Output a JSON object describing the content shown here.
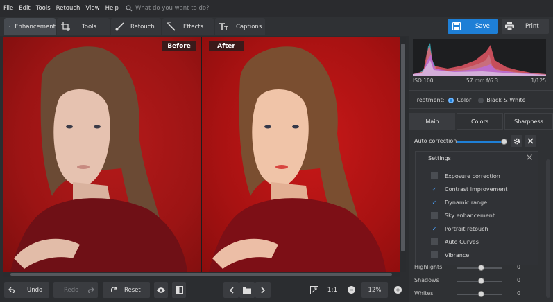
{
  "menu": {
    "items": [
      "File",
      "Edit",
      "Tools",
      "Retouch",
      "View",
      "Help"
    ],
    "search_placeholder": "What do you want to do?"
  },
  "toolbar": {
    "tabs": [
      {
        "label": "Enhancement",
        "icon": "sliders-icon"
      },
      {
        "label": "Tools",
        "icon": "crop-icon"
      },
      {
        "label": "Retouch",
        "icon": "brush-icon"
      },
      {
        "label": "Effects",
        "icon": "magic-wand-icon"
      },
      {
        "label": "Captions",
        "icon": "text-icon"
      }
    ],
    "save_label": "Save",
    "print_label": "Print"
  },
  "canvas": {
    "before_label": "Before",
    "after_label": "After"
  },
  "bottom": {
    "undo_label": "Undo",
    "redo_label": "Redo",
    "reset_label": "Reset",
    "one_to_one": "1:1",
    "zoom": "12%"
  },
  "panel": {
    "exif": {
      "iso": "ISO 100",
      "lens": "57 mm f/6.3",
      "shutter": "1/125"
    },
    "treatment_label": "Treatment:",
    "treatment_options": [
      "Color",
      "Black & White"
    ],
    "tabs": [
      "Main",
      "Colors",
      "Sharpness"
    ],
    "auto_correction_label": "Auto correction",
    "settings_title": "Settings",
    "settings_items": [
      {
        "label": "Exposure correction",
        "checked": false
      },
      {
        "label": "Contrast improvement",
        "checked": true
      },
      {
        "label": "Dynamic range",
        "checked": true
      },
      {
        "label": "Sky enhancement",
        "checked": false
      },
      {
        "label": "Portrait retouch",
        "checked": true
      },
      {
        "label": "Auto Curves",
        "checked": false
      },
      {
        "label": "Vibrance",
        "checked": false
      }
    ],
    "adjustments": [
      {
        "label": "Highlights",
        "value": "0"
      },
      {
        "label": "Shadows",
        "value": "0"
      },
      {
        "label": "Whites",
        "value": "0"
      }
    ]
  },
  "colors": {
    "accent": "#1e7fd6",
    "background": "#2b2d30",
    "photo_red": "#a81616"
  }
}
